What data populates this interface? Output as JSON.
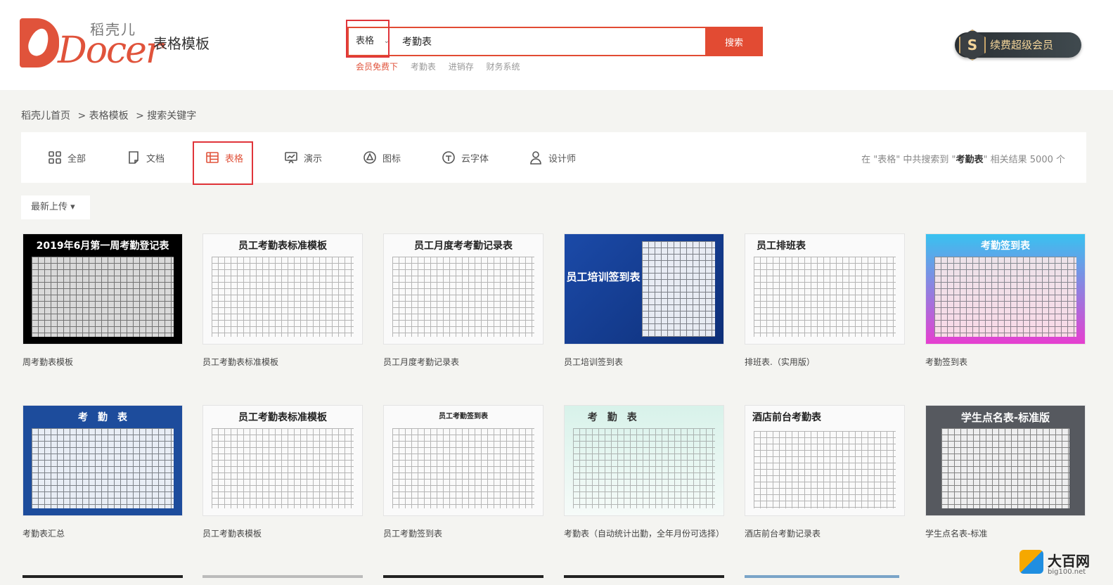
{
  "header": {
    "logo_cn": "稻壳儿",
    "logo_word": "Docer",
    "section": "表格模板",
    "search": {
      "category": "表格",
      "value": "考勤表",
      "button": "搜索"
    },
    "hot_keywords": [
      "会员免费下",
      "考勤表",
      "进销存",
      "财务系统"
    ],
    "vip": {
      "badge": "S",
      "label": "续费超级会员"
    }
  },
  "breadcrumb": [
    "稻壳儿首页",
    "> 表格模板",
    "> 搜索关键字"
  ],
  "filter": {
    "tabs": [
      {
        "label": "全部",
        "icon": "grid-icon"
      },
      {
        "label": "文档",
        "icon": "document-icon"
      },
      {
        "label": "表格",
        "icon": "table-icon"
      },
      {
        "label": "演示",
        "icon": "presentation-icon"
      },
      {
        "label": "图标",
        "icon": "circle-icon"
      },
      {
        "label": "云字体",
        "icon": "cloud-font-icon"
      },
      {
        "label": "设计师",
        "icon": "person-icon"
      }
    ],
    "active": "表格",
    "result": {
      "pre": "在 \"表格\" 中共搜索到 \"",
      "keyword": "考勤表",
      "post": "\" 相关结果 5000 个"
    }
  },
  "sort": {
    "label": "最新上传 ▾"
  },
  "templates": [
    {
      "title": "周考勤表模板",
      "thumb_title": "2019年6月第一周考勤登记表",
      "theme": "dark"
    },
    {
      "title": "员工考勤表标准模板",
      "thumb_title": "员工考勤表标准模板",
      "theme": "light"
    },
    {
      "title": "员工月度考勤记录表",
      "thumb_title": "员工月度考考勤记录表",
      "theme": "light"
    },
    {
      "title": "员工培训签到表",
      "thumb_title": "员工培训签到表",
      "theme": "blue"
    },
    {
      "title": "排班表.（实用版）",
      "thumb_title": "员工排班表",
      "theme": "light"
    },
    {
      "title": "考勤签到表",
      "thumb_title": "考勤签到表",
      "theme": "pink"
    },
    {
      "title": "考勤表汇总",
      "thumb_title": "考　勤　表",
      "theme": "navy"
    },
    {
      "title": "员工考勤表模板",
      "thumb_title": "员工考勤表标准模板",
      "theme": "light"
    },
    {
      "title": "员工考勤签到表",
      "thumb_title": "员工考勤签到表",
      "theme": "light"
    },
    {
      "title": "考勤表（自动统计出勤，全年月份可选择）",
      "thumb_title": "考　勤　表",
      "theme": "mint"
    },
    {
      "title": "酒店前台考勤记录表",
      "thumb_title": "酒店前台考勤表",
      "theme": "light"
    },
    {
      "title": "学生点名表-标准",
      "thumb_title": "学生点名表-标准版",
      "theme": "gray"
    }
  ],
  "watermark": {
    "text": "大百网",
    "url": "big100.net"
  }
}
